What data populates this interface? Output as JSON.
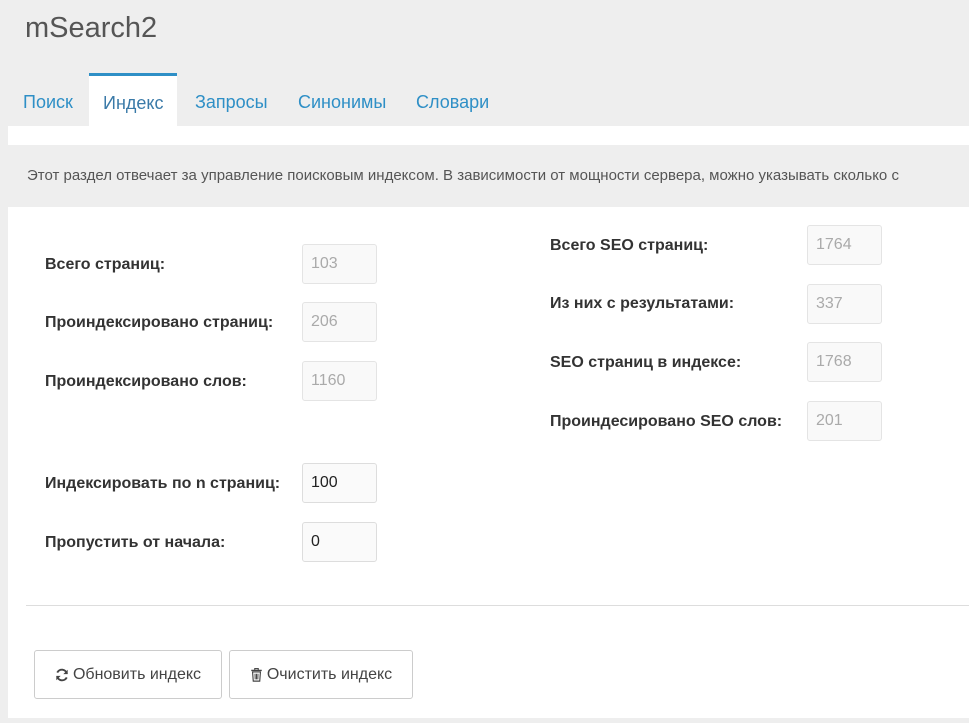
{
  "app": {
    "title": "mSearch2"
  },
  "tabs": [
    {
      "label": "Поиск"
    },
    {
      "label": "Индекс",
      "active": true
    },
    {
      "label": "Запросы"
    },
    {
      "label": "Синонимы"
    },
    {
      "label": "Словари"
    }
  ],
  "description": "Этот раздел отвечает за управление поисковым индексом. В зависимости от мощности сервера, можно указывать сколько с",
  "stats_left": [
    {
      "label": "Всего страниц:",
      "value": "103"
    },
    {
      "label": "Проиндексировано страниц:",
      "value": "206"
    },
    {
      "label": "Проиндексировано слов:",
      "value": "1160"
    }
  ],
  "stats_right": [
    {
      "label": "Всего SEO страниц:",
      "value": "1764"
    },
    {
      "label": "Из них с результатами:",
      "value": "337"
    },
    {
      "label": "SEO страниц в индексе:",
      "value": "1768"
    },
    {
      "label": "Проиндесировано SEO слов:",
      "value": "201"
    }
  ],
  "settings": [
    {
      "label": "Индексировать по n страниц:",
      "value": "100"
    },
    {
      "label": "Пропустить от начала:",
      "value": "0"
    }
  ],
  "buttons": {
    "refresh": {
      "label": "Обновить индекс",
      "icon": "refresh-icon"
    },
    "clear": {
      "label": "Очистить индекс",
      "icon": "trash-icon"
    }
  },
  "colors": {
    "accent": "#2e8fc6",
    "background": "#eeeeee",
    "panel": "#ffffff"
  }
}
